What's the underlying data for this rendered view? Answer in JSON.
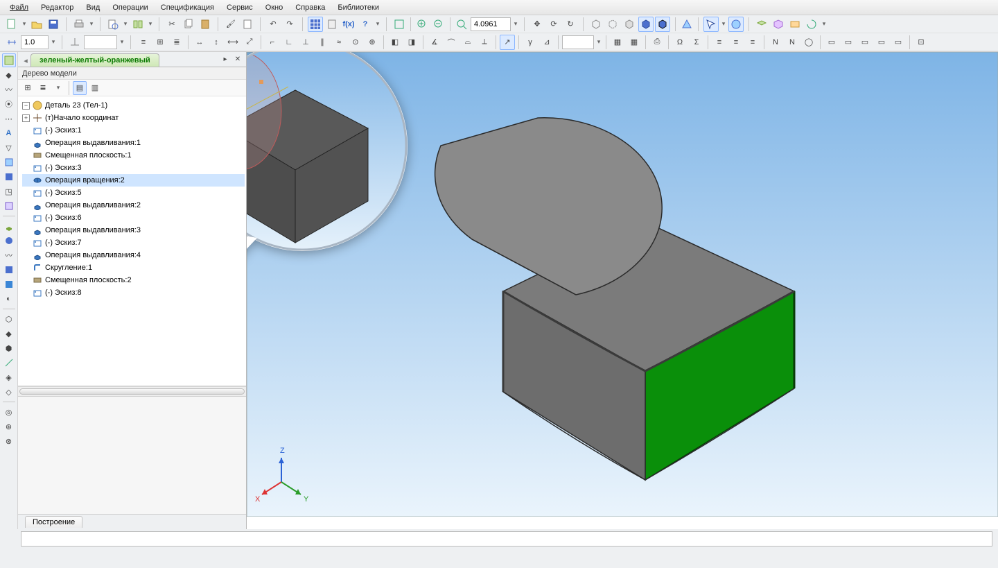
{
  "menu": {
    "items": [
      "Файл",
      "Редактор",
      "Вид",
      "Операции",
      "Спецификация",
      "Сервис",
      "Окно",
      "Справка",
      "Библиотеки"
    ]
  },
  "toolbar": {
    "zoom_value": "4.0961",
    "size_value": "1.0",
    "second_value": ""
  },
  "tab": {
    "title": "зеленый-желтый-оранжевый"
  },
  "side": {
    "tree_title": "Дерево модели",
    "root": "Деталь 23 (Тел-1)",
    "items": [
      {
        "icon": "origin-icon",
        "label": "(т)Начало координат",
        "twisty": "+"
      },
      {
        "icon": "sketch-icon",
        "label": "(-) Эскиз:1"
      },
      {
        "icon": "extrude-icon",
        "label": "Операция выдавливания:1"
      },
      {
        "icon": "plane-icon",
        "label": "Смещенная плоскость:1"
      },
      {
        "icon": "sketch-icon",
        "label": "(-) Эскиз:3"
      },
      {
        "icon": "revolve-icon",
        "label": "Операция вращения:2",
        "selected": true
      },
      {
        "icon": "sketch-icon",
        "label": "(-) Эскиз:5"
      },
      {
        "icon": "extrude-icon",
        "label": "Операция выдавливания:2"
      },
      {
        "icon": "sketch-icon",
        "label": "(-) Эскиз:6"
      },
      {
        "icon": "extrude-icon",
        "label": "Операция выдавливания:3"
      },
      {
        "icon": "sketch-icon",
        "label": "(-) Эскиз:7"
      },
      {
        "icon": "extrude-icon",
        "label": "Операция выдавливания:4"
      },
      {
        "icon": "fillet-icon",
        "label": "Скругление:1"
      },
      {
        "icon": "plane-icon",
        "label": "Смещенная плоскость:2"
      },
      {
        "icon": "sketch-icon",
        "label": "(-) Эскиз:8"
      }
    ],
    "bottom_tab": "Построение"
  },
  "viewport": {
    "axes": {
      "x": "X",
      "y": "Y",
      "z": "Z"
    }
  }
}
